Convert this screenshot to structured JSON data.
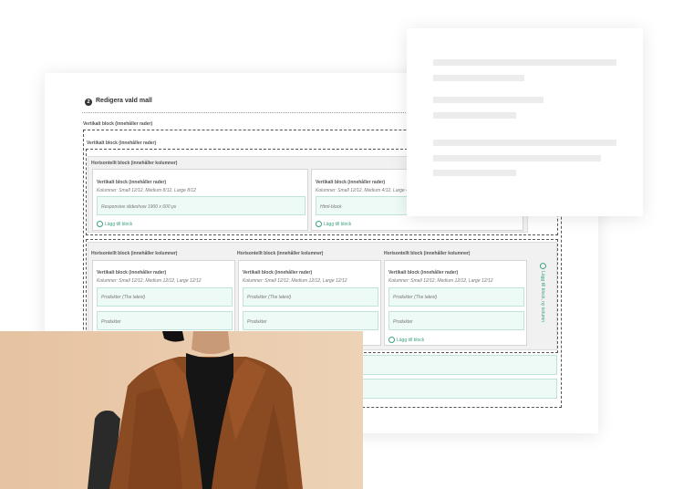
{
  "editor": {
    "step_number": "2",
    "title": "Redigera vald mall",
    "outer_label": "Vertikalt block (innehåller rader)",
    "inner_label": "Vertikalt block (innehåller rader)",
    "row1_label": "Horisontellt block (innehåller kolumner)",
    "row1_columns": [
      {
        "label": "Vertikalt block (innehåller rader)",
        "sub": "Kolumner: Small 12/12, Medium 8/12, Large 8/12",
        "item": "Responsive slideshow 1900 x 600 px",
        "add": "Lägg till block"
      },
      {
        "label": "Vertikalt block (innehåller rader)",
        "sub": "Kolumner: Small 12/12, Medium 4/12, Large 4/12",
        "item": "Html-block",
        "add": "Lägg till block"
      }
    ],
    "row2_columns": [
      {
        "hlabel": "Horisontellt block (innehåller kolumner)",
        "label": "Vertikalt block (innehåller rader)",
        "sub": "Kolumner: Small 12/12, Medium 12/12, Large 12/12",
        "item1": "Produkter (The latest)",
        "item2": "Produkter"
      },
      {
        "hlabel": "Horisontellt block (innehåller kolumner)",
        "label": "Vertikalt block (innehåller rader)",
        "sub": "Kolumner: Small 12/12, Medium 12/12, Large 12/12",
        "item1": "Produkter (The latest)",
        "item2": "Produkter"
      },
      {
        "hlabel": "Horisontellt block (innehåller kolumner)",
        "label": "Vertikalt block (innehåller rader)",
        "sub": "Kolumner: Small 12/12, Medium 12/12, Large 12/12",
        "item1": "Produkter (The latest)",
        "item2": "Produkter",
        "add": "Lägg till block"
      }
    ],
    "side_add": "Lägg till block, ny kolumn"
  },
  "colors": {
    "accent": "#3aa27e",
    "mint_fill": "#eefaf6",
    "photo_bg": "#e8c7a6",
    "coat": "#8a4a22"
  }
}
